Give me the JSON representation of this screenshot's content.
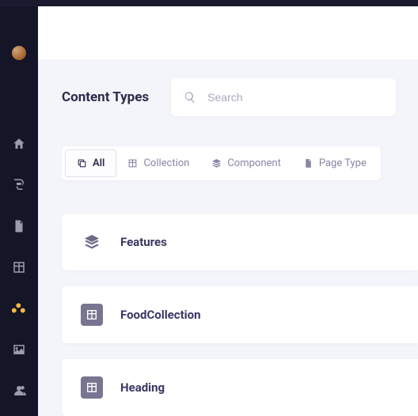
{
  "page": {
    "title": "Content Types"
  },
  "search": {
    "placeholder": "Search",
    "value": ""
  },
  "filters": {
    "all": "All",
    "collection": "Collection",
    "component": "Component",
    "pageType": "Page Type"
  },
  "types": [
    {
      "name": "Features",
      "kind": "component"
    },
    {
      "name": "FoodCollection",
      "kind": "collection"
    },
    {
      "name": "Heading",
      "kind": "collection"
    }
  ],
  "sidebar": {
    "items": [
      "home",
      "blog",
      "document",
      "table",
      "modules",
      "image",
      "users"
    ]
  }
}
